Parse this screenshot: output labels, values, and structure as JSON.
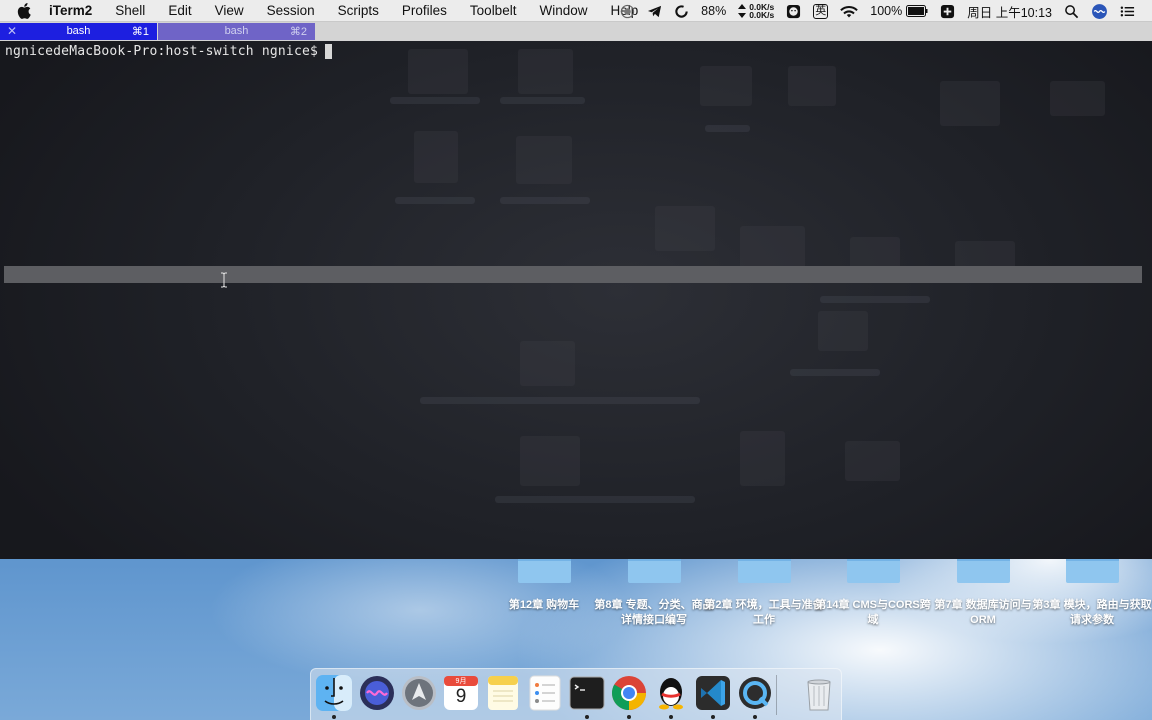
{
  "menubar": {
    "app_name": "iTerm2",
    "items": [
      "Shell",
      "Edit",
      "View",
      "Session",
      "Scripts",
      "Profiles",
      "Toolbelt",
      "Window",
      "Help"
    ],
    "status": {
      "battery_icon_text": "88%",
      "net_up": "0.0K/s",
      "net_down": "0.0K/s",
      "input_method": "英",
      "battery_percent": "100%",
      "datetime": "周日 上午10:13"
    }
  },
  "tabs": [
    {
      "label": "bash",
      "shortcut": "⌘1",
      "active": true,
      "close": "✕"
    },
    {
      "label": "bash",
      "shortcut": "⌘2",
      "active": false
    }
  ],
  "terminal": {
    "prompt": "ngnicedeMacBook-Pro:host-switch ngnice$"
  },
  "desktop_folders": [
    {
      "label": "第12章 购物车"
    },
    {
      "label": "第8章 专题、分类、商品详情接口编写"
    },
    {
      "label": "第2章 环境，工具与准备工作"
    },
    {
      "label": "第14章 CMS与CORS跨域"
    },
    {
      "label": "第7章 数据库访问与ORM"
    },
    {
      "label": "第3章 模块，路由与获取请求参数"
    }
  ],
  "dock": {
    "apps": [
      "finder-icon",
      "siri-icon",
      "launchpad-icon",
      "calendar-icon",
      "notes-icon",
      "reminders-icon",
      "terminal-icon",
      "chrome-icon",
      "qq-icon",
      "vscode-icon",
      "quicktime-icon",
      "trash-icon"
    ],
    "calendar": {
      "month": "9月",
      "day": "9"
    }
  },
  "colors": {
    "active_tab": "#1d1fe0",
    "inactive_tab": "#6f64c7",
    "terminal_bg": "#1f2127"
  }
}
